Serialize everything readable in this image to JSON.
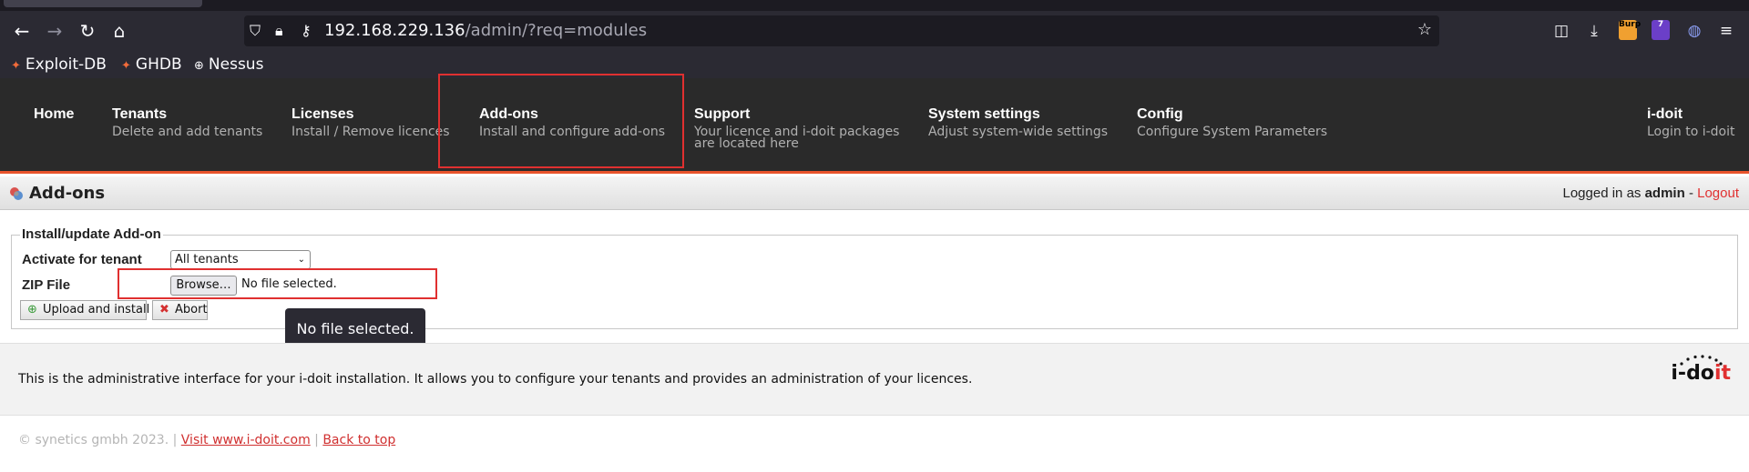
{
  "browser": {
    "url_host": "192.168.229.136",
    "url_path": "/admin/?req=modules",
    "extension_badge": "7",
    "extension_label": "Burp"
  },
  "bookmarks": [
    {
      "label": "Exploit-DB",
      "icon": "bug-icon"
    },
    {
      "label": "GHDB",
      "icon": "bug-icon"
    },
    {
      "label": "Nessus",
      "icon": "globe-icon"
    }
  ],
  "nav": {
    "home": {
      "title": "Home"
    },
    "tenants": {
      "title": "Tenants",
      "sub": "Delete and add tenants"
    },
    "licenses": {
      "title": "Licenses",
      "sub": "Install / Remove licences"
    },
    "addons": {
      "title": "Add-ons",
      "sub": "Install and configure add-ons"
    },
    "support": {
      "title": "Support",
      "sub1": "Your licence and i-doit packages",
      "sub2": "are located here"
    },
    "system": {
      "title": "System settings",
      "sub": "Adjust system-wide settings"
    },
    "config": {
      "title": "Config",
      "sub": "Configure System Parameters"
    },
    "idoit": {
      "title": "i-doit",
      "sub": "Login to i-doit"
    }
  },
  "page": {
    "title": "Add-ons",
    "logged_in_prefix": "Logged in as",
    "user": "admin",
    "separator": "-",
    "logout": "Logout"
  },
  "form": {
    "legend": "Install/update Add-on",
    "tenant_label": "Activate for tenant",
    "tenant_value": "All tenants",
    "zip_label": "ZIP File",
    "browse_label": "Browse…",
    "file_status": "No file selected.",
    "upload_label": "Upload and install",
    "abort_label": "Abort",
    "tooltip": "No file selected."
  },
  "info": {
    "text": "This is the administrative interface for your i-doit installation. It allows you to configure your tenants and provides an administration of your licences.",
    "logo_main": "i-do",
    "logo_accent": "it"
  },
  "footer": {
    "copyright": "© synetics gmbh 2023.",
    "sep": "|",
    "visit_link": "Visit www.i-doit.com",
    "top_link": "Back to top"
  },
  "colors": {
    "accent": "#e8532b",
    "link": "#d03030",
    "header_bg": "#2a2a2a"
  }
}
